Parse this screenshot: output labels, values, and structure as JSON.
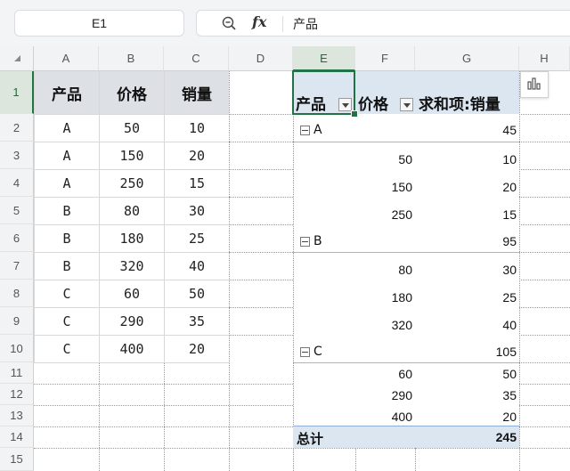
{
  "formula_bar": {
    "name_box": "E1",
    "fx_label": "fx",
    "formula_value": "产品"
  },
  "columns": [
    "A",
    "B",
    "C",
    "D",
    "E",
    "F",
    "G",
    "H"
  ],
  "rows": [
    "1",
    "2",
    "3",
    "4",
    "5",
    "6",
    "7",
    "8",
    "9",
    "10",
    "11",
    "12",
    "13",
    "14",
    "15"
  ],
  "source_table": {
    "headers": [
      "产品",
      "价格",
      "销量"
    ],
    "rows": [
      [
        "A",
        "50",
        "10"
      ],
      [
        "A",
        "150",
        "20"
      ],
      [
        "A",
        "250",
        "15"
      ],
      [
        "B",
        "80",
        "30"
      ],
      [
        "B",
        "180",
        "25"
      ],
      [
        "B",
        "320",
        "40"
      ],
      [
        "C",
        "60",
        "50"
      ],
      [
        "C",
        "290",
        "35"
      ],
      [
        "C",
        "400",
        "20"
      ]
    ]
  },
  "pivot": {
    "header_product": "产品",
    "header_price": "价格",
    "header_sum": "求和项:销量",
    "groups": [
      {
        "name": "A",
        "total": "45",
        "items": [
          [
            "50",
            "10"
          ],
          [
            "150",
            "20"
          ],
          [
            "250",
            "15"
          ]
        ]
      },
      {
        "name": "B",
        "total": "95",
        "items": [
          [
            "80",
            "30"
          ],
          [
            "180",
            "25"
          ],
          [
            "320",
            "40"
          ]
        ]
      },
      {
        "name": "C",
        "total": "105",
        "items": [
          [
            "60",
            "50"
          ],
          [
            "290",
            "35"
          ],
          [
            "400",
            "20"
          ]
        ]
      }
    ],
    "grand_total_label": "总计",
    "grand_total_value": "245"
  },
  "colors": {
    "selection": "#217346",
    "pivot_header": "#dce6f1",
    "table_header": "#dde1e6"
  }
}
